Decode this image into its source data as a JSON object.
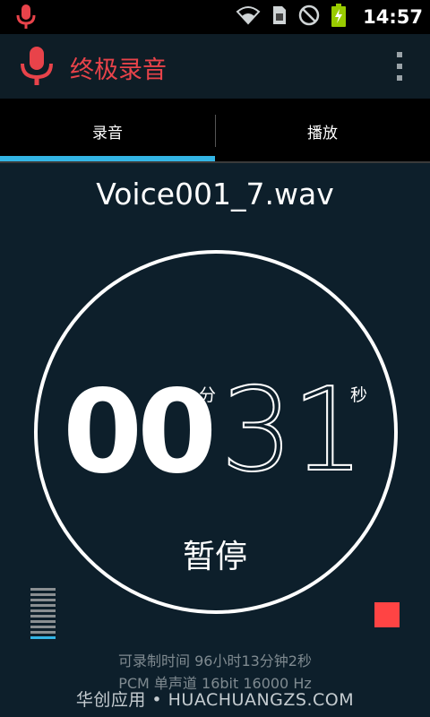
{
  "status_bar": {
    "time": "14:57"
  },
  "app": {
    "title": "终极录音"
  },
  "tabs": [
    {
      "label": "录音",
      "active": true
    },
    {
      "label": "播放",
      "active": false
    }
  ],
  "recording": {
    "filename": "Voice001_7.wav",
    "minutes": "00",
    "minutes_unit": "分",
    "seconds": "31",
    "seconds_unit": "秒",
    "pause_label": "暂停",
    "remaining": "可录制时间 96小时13分钟2秒",
    "format": "PCM 单声道 16bit 16000 Hz",
    "level_fraction": 0.1
  },
  "watermark": "华创应用 • HUACHUANGZS.COM",
  "colors": {
    "accent": "#33b5e5",
    "brand_red": "#e8434a",
    "stop": "#ff4444",
    "background": "#0d1f2b"
  },
  "icons": [
    "microphone-icon",
    "wifi-icon",
    "sim-icon",
    "do-not-disturb-icon",
    "battery-charging-icon",
    "overflow-menu-icon",
    "stop-icon"
  ]
}
